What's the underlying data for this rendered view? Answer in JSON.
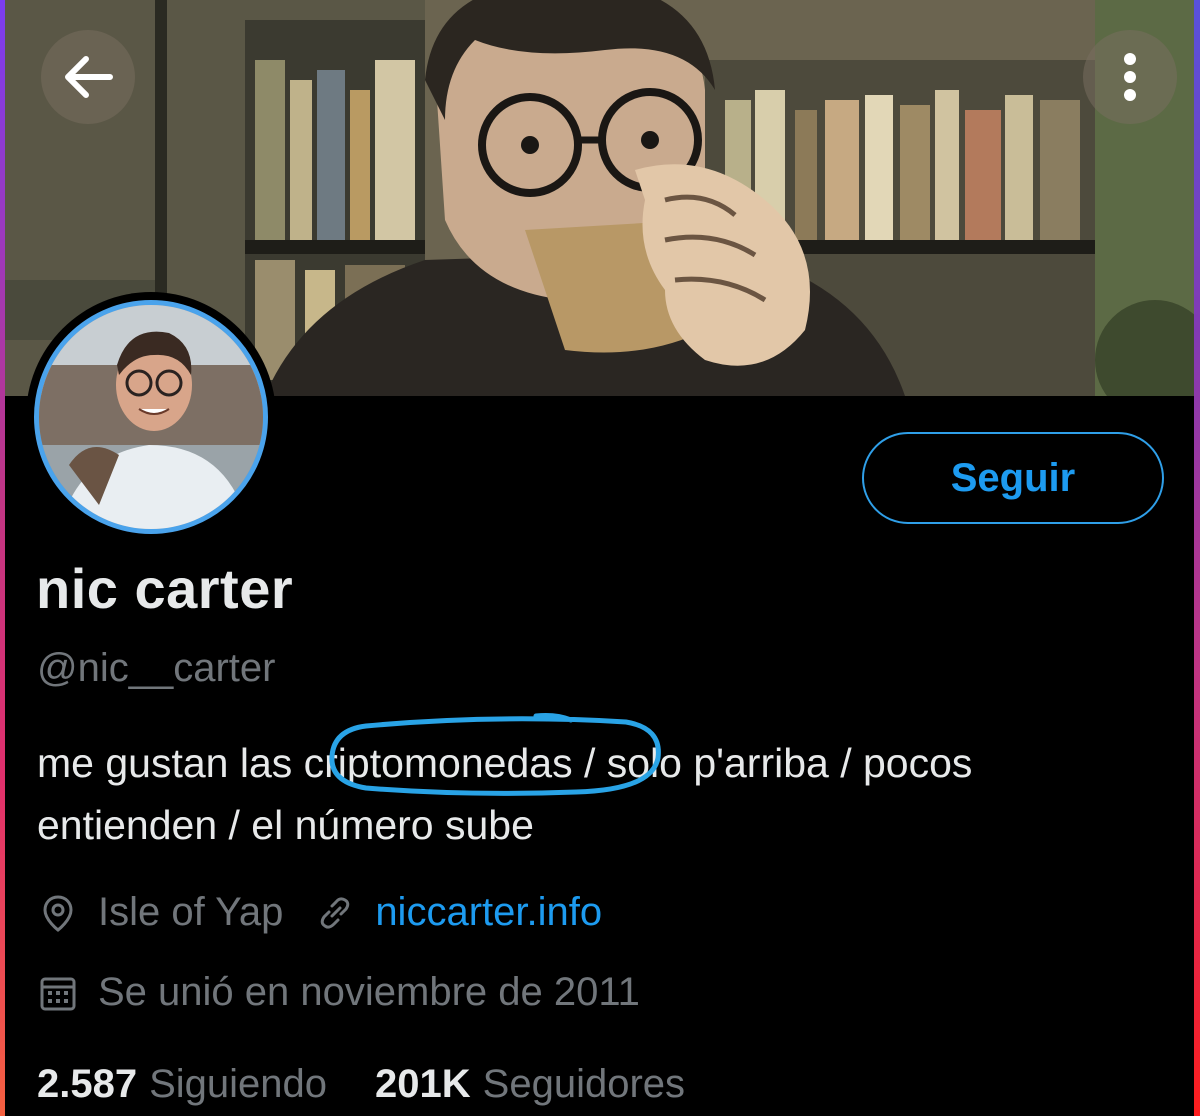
{
  "profile": {
    "display_name": "nic carter",
    "handle": "@nic__carter",
    "bio_before": "me gustan las ",
    "bio_highlight": "criptomonedas",
    "bio_after": " / solo p'arriba / pocos entienden / el número sube",
    "location": "Isle of Yap",
    "website": "niccarter.info",
    "joined": "Se unió en noviembre de 2011",
    "following_count": "2.587",
    "following_label": "Siguiendo",
    "followers_count": "201K",
    "followers_label": "Seguidores"
  },
  "actions": {
    "follow_label": "Seguir"
  },
  "icons": {
    "back": "arrow-left-icon",
    "more": "more-vertical-icon",
    "location": "location-pin-icon",
    "link": "link-icon",
    "calendar": "calendar-icon"
  },
  "colors": {
    "accent": "#1d9bf0",
    "avatar_ring": "#4aa3ec",
    "highlight_circle": "#29a3e6",
    "background": "#000000",
    "primary_text": "#e7e9ea",
    "secondary_text": "#71767b"
  }
}
